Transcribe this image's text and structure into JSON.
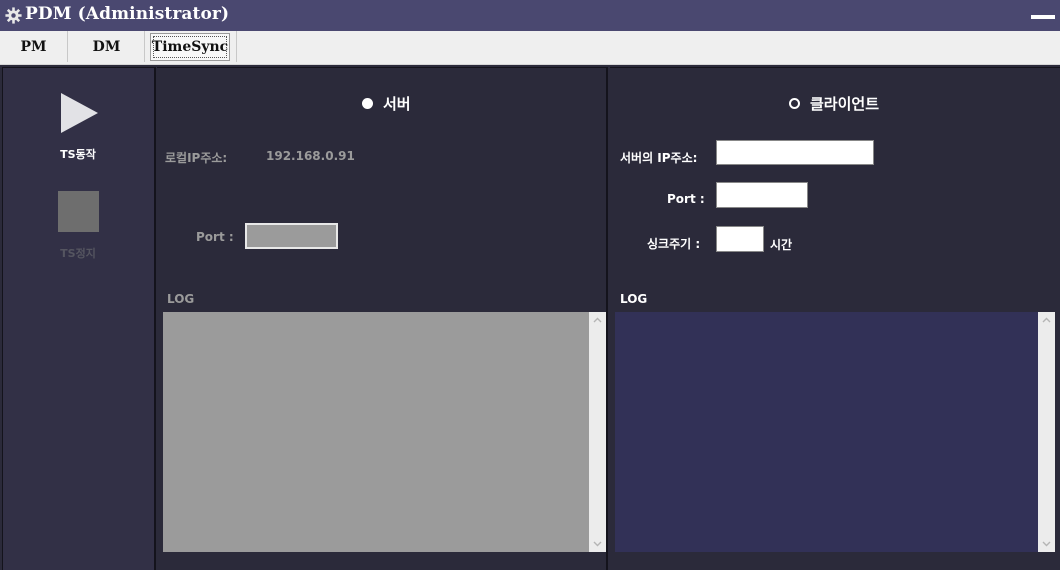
{
  "window": {
    "title": "PDM (Administrator)"
  },
  "menu": {
    "tabs": [
      {
        "label": "PM"
      },
      {
        "label": "DM"
      },
      {
        "label": "TimeSync"
      }
    ],
    "active": "TimeSync"
  },
  "sidebar": {
    "start_label": "TS동작",
    "stop_label": "TS정지"
  },
  "server": {
    "radio_label": "서버",
    "selected": true,
    "local_ip_label": "로컬IP주소:",
    "local_ip_value": "192.168.0.91",
    "port_label": "Port :",
    "port_value": "",
    "log_label": "LOG"
  },
  "client": {
    "radio_label": "클라이언트",
    "selected": false,
    "server_ip_label": "서버의 IP주소:",
    "server_ip_value": "",
    "port_label": "Port :",
    "port_value": "",
    "sync_label": "싱크주기 :",
    "sync_value": "",
    "sync_unit": "시간",
    "log_label": "LOG"
  },
  "colors": {
    "titlebar": "#4a4870",
    "background": "#2b2a3a",
    "sidebar": "#323046",
    "server_log": "#9b9b9b",
    "client_log": "#323157"
  }
}
